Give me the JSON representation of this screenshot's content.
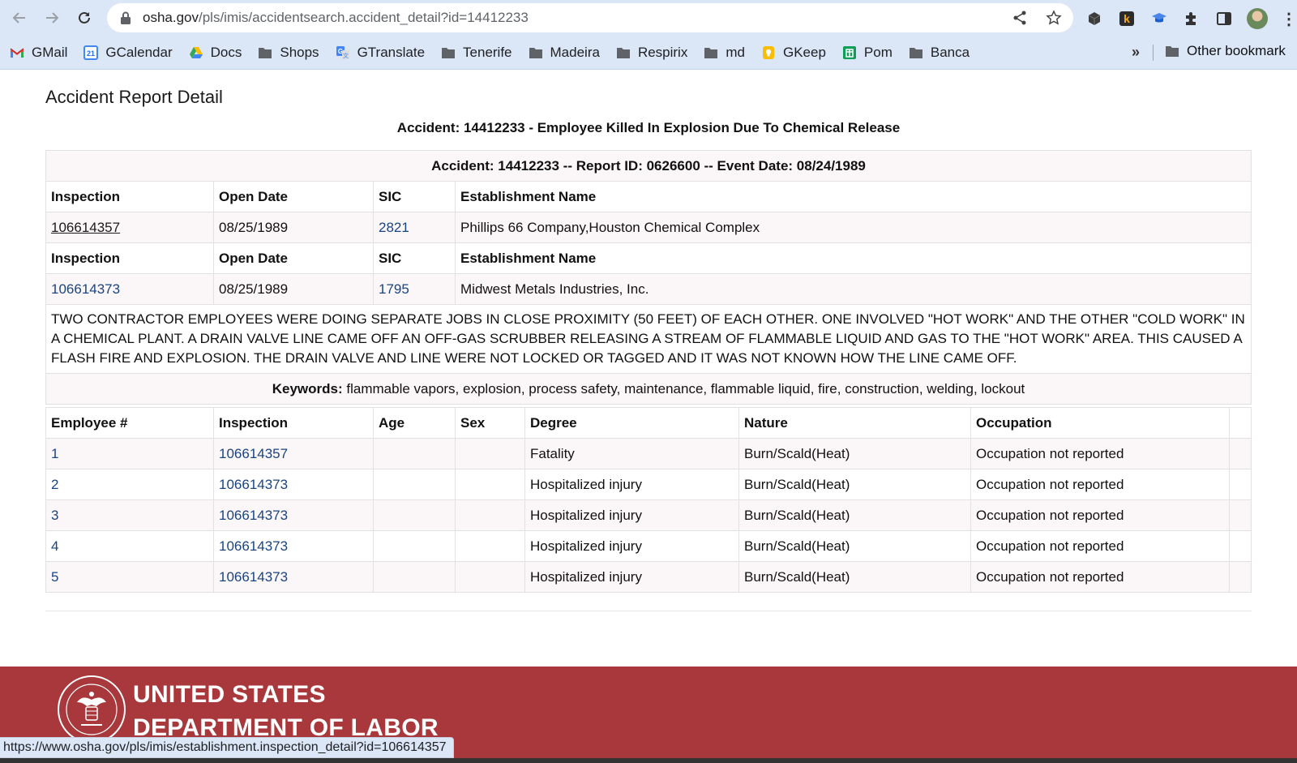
{
  "browser": {
    "url_domain": "osha.gov",
    "url_path": "/pls/imis/accidentsearch.accident_detail?id=14412233",
    "bookmarks": [
      {
        "label": "GMail",
        "icon": "gmail-icon"
      },
      {
        "label": "GCalendar",
        "icon": "calendar-icon"
      },
      {
        "label": "Docs",
        "icon": "drive-icon"
      },
      {
        "label": "Shops",
        "icon": "folder-icon"
      },
      {
        "label": "GTranslate",
        "icon": "translate-icon"
      },
      {
        "label": "Tenerife",
        "icon": "folder-icon"
      },
      {
        "label": "Madeira",
        "icon": "folder-icon"
      },
      {
        "label": "Respirix",
        "icon": "folder-icon"
      },
      {
        "label": "md",
        "icon": "folder-icon"
      },
      {
        "label": "GKeep",
        "icon": "keep-icon"
      },
      {
        "label": "Pom",
        "icon": "sheets-icon"
      },
      {
        "label": "Banca",
        "icon": "folder-icon"
      }
    ],
    "more_bookmarks": "»",
    "other_bookmarks": "Other bookmark",
    "status_url": "https://www.osha.gov/pls/imis/establishment.inspection_detail?id=106614357"
  },
  "page": {
    "heading": "Accident Report Detail",
    "title": "Accident: 14412233 - Employee Killed In Explosion Due To Chemical Release",
    "summary_header": "Accident: 14412233 -- Report ID: 0626600 -- Event Date: 08/24/1989",
    "inspection_headers": {
      "inspection": "Inspection",
      "open_date": "Open Date",
      "sic": "SIC",
      "establishment": "Establishment Name"
    },
    "inspections": [
      {
        "inspection": "106614357",
        "open_date": "08/25/1989",
        "sic": "2821",
        "establishment": "Phillips 66 Company,Houston Chemical Complex"
      },
      {
        "inspection": "106614373",
        "open_date": "08/25/1989",
        "sic": "1795",
        "establishment": "Midwest Metals Industries, Inc."
      }
    ],
    "narrative": "TWO CONTRACTOR EMPLOYEES WERE DOING SEPARATE JOBS IN CLOSE PROXIMITY (50 FEET) OF EACH OTHER. ONE INVOLVED \"HOT WORK\" AND THE OTHER \"COLD WORK\" IN A CHEMICAL PLANT. A DRAIN VALVE LINE CAME OFF AN OFF-GAS SCRUBBER RELEASING A STREAM OF FLAMMABLE LIQUID AND GAS TO THE \"HOT WORK\" AREA. THIS CAUSED A FLASH FIRE AND EXPLOSION. THE DRAIN VALVE AND LINE WERE NOT LOCKED OR TAGGED AND IT WAS NOT KNOWN HOW THE LINE CAME OFF.",
    "keywords_label": "Keywords:",
    "keywords": "flammable vapors, explosion, process safety, maintenance, flammable liquid, fire, construction, welding, lockout",
    "employee_headers": {
      "employee": "Employee #",
      "inspection": "Inspection",
      "age": "Age",
      "sex": "Sex",
      "degree": "Degree",
      "nature": "Nature",
      "occupation": "Occupation"
    },
    "employees": [
      {
        "employee": "1",
        "inspection": "106614357",
        "age": "",
        "sex": "",
        "degree": "Fatality",
        "nature": "Burn/Scald(Heat)",
        "occupation": "Occupation not reported"
      },
      {
        "employee": "2",
        "inspection": "106614373",
        "age": "",
        "sex": "",
        "degree": "Hospitalized injury",
        "nature": "Burn/Scald(Heat)",
        "occupation": "Occupation not reported"
      },
      {
        "employee": "3",
        "inspection": "106614373",
        "age": "",
        "sex": "",
        "degree": "Hospitalized injury",
        "nature": "Burn/Scald(Heat)",
        "occupation": "Occupation not reported"
      },
      {
        "employee": "4",
        "inspection": "106614373",
        "age": "",
        "sex": "",
        "degree": "Hospitalized injury",
        "nature": "Burn/Scald(Heat)",
        "occupation": "Occupation not reported"
      },
      {
        "employee": "5",
        "inspection": "106614373",
        "age": "",
        "sex": "",
        "degree": "Hospitalized injury",
        "nature": "Burn/Scald(Heat)",
        "occupation": "Occupation not reported"
      }
    ]
  },
  "footer": {
    "line1": "UNITED STATES",
    "line2": "DEPARTMENT OF LABOR",
    "seal_icon": "dol-seal-icon",
    "color": "#a8383b"
  }
}
